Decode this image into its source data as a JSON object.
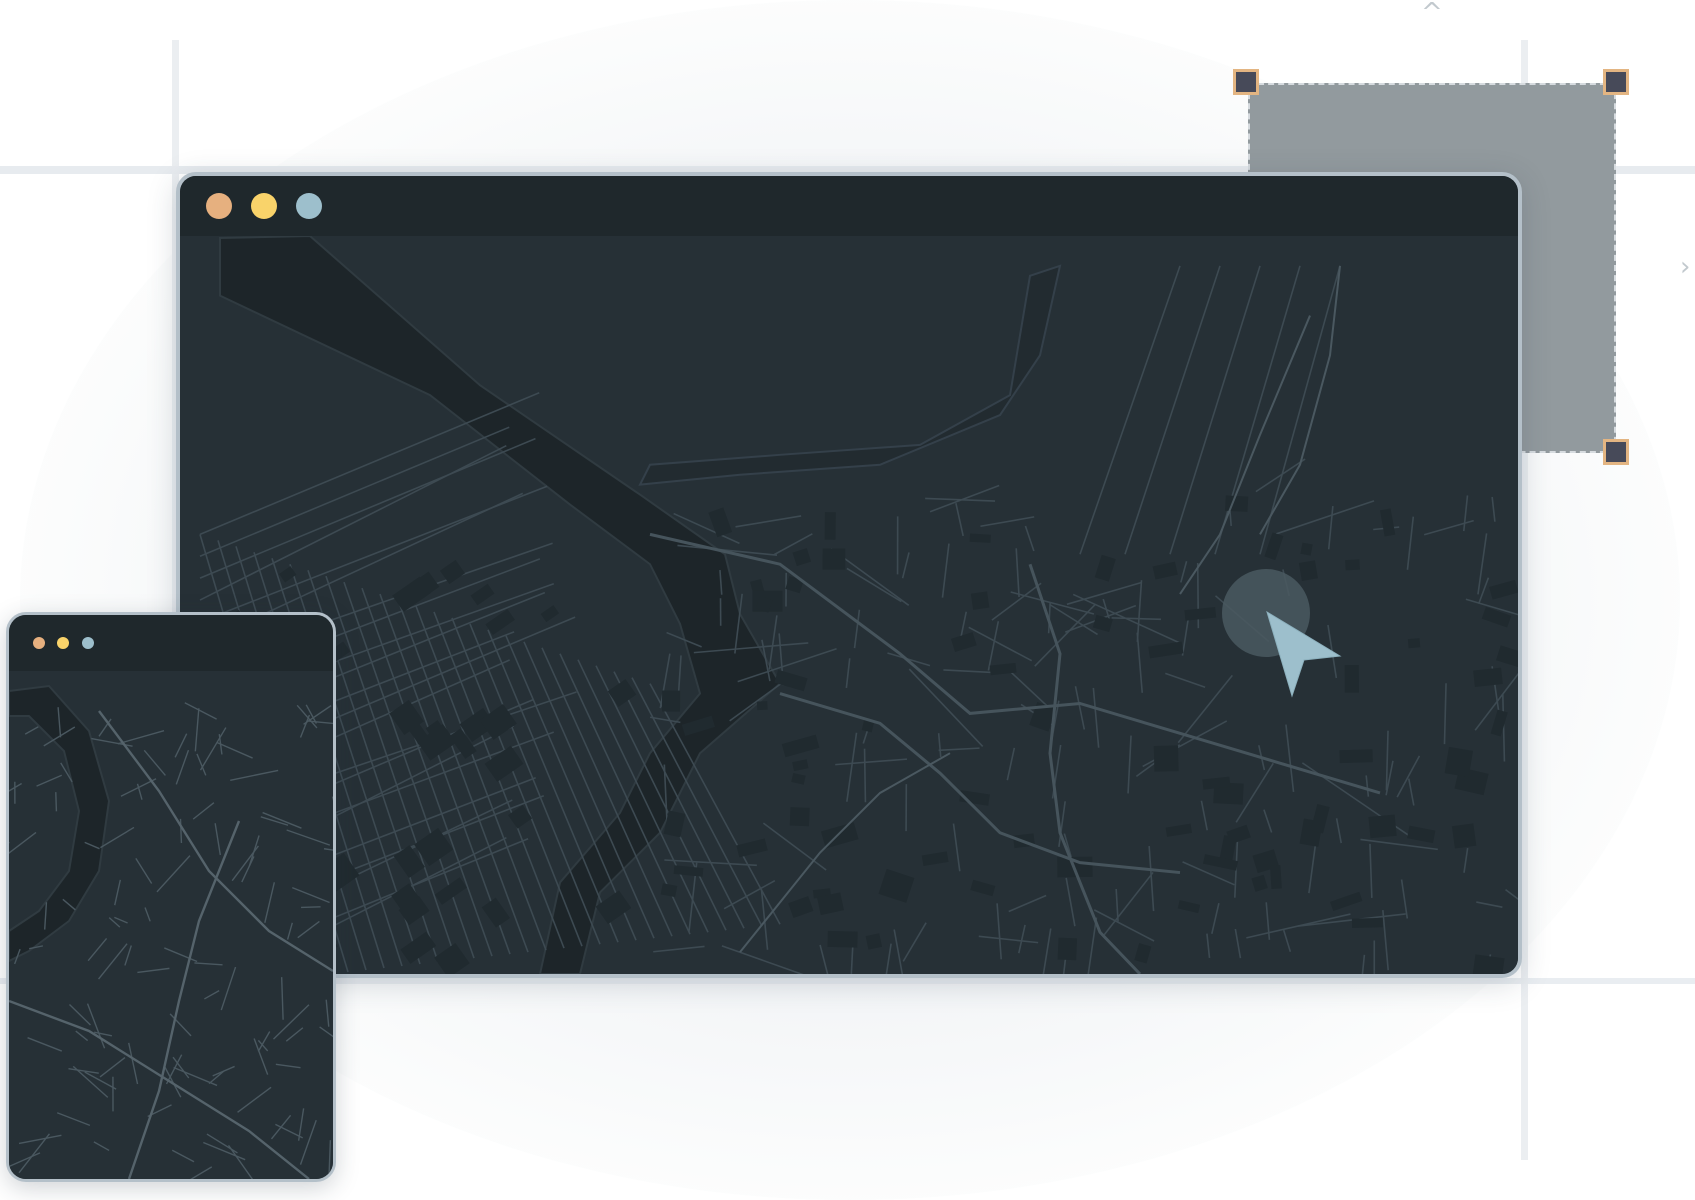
{
  "app": {
    "main_window": {
      "traffic_lights": [
        {
          "name": "close",
          "color": "#e6b07f"
        },
        {
          "name": "minimize",
          "color": "#f9d36a"
        },
        {
          "name": "zoom",
          "color": "#9dbfcc"
        }
      ],
      "content": "dark-street-map"
    },
    "secondary_window": {
      "traffic_lights": [
        {
          "name": "close",
          "color": "#e6b07f"
        },
        {
          "name": "minimize",
          "color": "#f9d36a"
        },
        {
          "name": "zoom",
          "color": "#9dbfcc"
        }
      ],
      "content": "dark-street-map"
    }
  },
  "selection": {
    "fill": "#929a9e",
    "handle_color": "#474a59",
    "handle_border": "#e3b582",
    "handles": [
      "top-left",
      "top-right",
      "bottom-right"
    ]
  },
  "indicators": {
    "up_arrow": "^",
    "right_arrow": "›"
  },
  "cursor": {
    "icon": "pointer-arrow-icon",
    "color": "#9dbfcc",
    "highlight": "click-ripple"
  },
  "theme": {
    "map_background": "#263036",
    "titlebar": "#1f282c",
    "street_stroke": "#3e4b53",
    "water": "#1d2529"
  }
}
